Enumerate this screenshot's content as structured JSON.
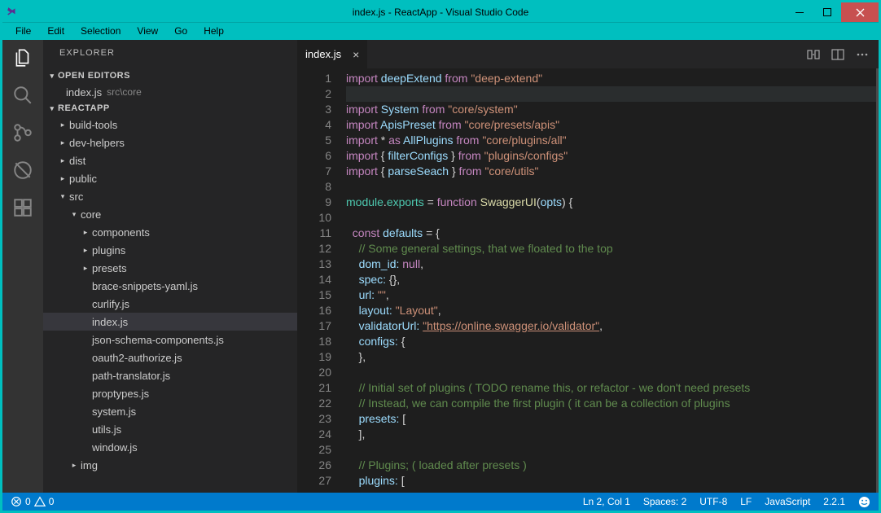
{
  "window": {
    "title": "index.js - ReactApp - Visual Studio Code"
  },
  "menubar": [
    "File",
    "Edit",
    "Selection",
    "View",
    "Go",
    "Help"
  ],
  "activitybar": [
    "files",
    "search",
    "scm",
    "debug",
    "extensions"
  ],
  "explorer": {
    "title": "EXPLORER",
    "sections": {
      "open_editors_label": "OPEN EDITORS",
      "open_editors": [
        {
          "name": "index.js",
          "hint": "src\\core"
        }
      ],
      "project_label": "REACTAPP",
      "tree": [
        {
          "indent": 0,
          "chev": "right",
          "label": "build-tools"
        },
        {
          "indent": 0,
          "chev": "right",
          "label": "dev-helpers"
        },
        {
          "indent": 0,
          "chev": "right",
          "label": "dist"
        },
        {
          "indent": 0,
          "chev": "right",
          "label": "public"
        },
        {
          "indent": 0,
          "chev": "down",
          "label": "src"
        },
        {
          "indent": 1,
          "chev": "down",
          "label": "core"
        },
        {
          "indent": 2,
          "chev": "right",
          "label": "components"
        },
        {
          "indent": 2,
          "chev": "right",
          "label": "plugins"
        },
        {
          "indent": 2,
          "chev": "right",
          "label": "presets"
        },
        {
          "indent": 2,
          "chev": "",
          "label": "brace-snippets-yaml.js"
        },
        {
          "indent": 2,
          "chev": "",
          "label": "curlify.js"
        },
        {
          "indent": 2,
          "chev": "",
          "label": "index.js",
          "selected": true
        },
        {
          "indent": 2,
          "chev": "",
          "label": "json-schema-components.js"
        },
        {
          "indent": 2,
          "chev": "",
          "label": "oauth2-authorize.js"
        },
        {
          "indent": 2,
          "chev": "",
          "label": "path-translator.js"
        },
        {
          "indent": 2,
          "chev": "",
          "label": "proptypes.js"
        },
        {
          "indent": 2,
          "chev": "",
          "label": "system.js"
        },
        {
          "indent": 2,
          "chev": "",
          "label": "utils.js"
        },
        {
          "indent": 2,
          "chev": "",
          "label": "window.js"
        },
        {
          "indent": 1,
          "chev": "right",
          "label": "img"
        }
      ]
    }
  },
  "tabs": {
    "active": "index.js"
  },
  "code": {
    "first_line": 1,
    "highlighted_line": 2,
    "lines": [
      [
        [
          "k",
          "import "
        ],
        [
          "id",
          "deepExtend"
        ],
        [
          "k",
          " from "
        ],
        [
          "s",
          "\"deep-extend\""
        ]
      ],
      [],
      [
        [
          "k",
          "import "
        ],
        [
          "id",
          "System"
        ],
        [
          "k",
          " from "
        ],
        [
          "s",
          "\"core/system\""
        ]
      ],
      [
        [
          "k",
          "import "
        ],
        [
          "id",
          "ApisPreset"
        ],
        [
          "k",
          " from "
        ],
        [
          "s",
          "\"core/presets/apis\""
        ]
      ],
      [
        [
          "k",
          "import "
        ],
        [
          "pu",
          "* "
        ],
        [
          "k",
          "as "
        ],
        [
          "id",
          "AllPlugins"
        ],
        [
          "k",
          " from "
        ],
        [
          "s",
          "\"core/plugins/all\""
        ]
      ],
      [
        [
          "k",
          "import "
        ],
        [
          "pu",
          "{ "
        ],
        [
          "id",
          "filterConfigs"
        ],
        [
          "pu",
          " }"
        ],
        [
          "k",
          " from "
        ],
        [
          "s",
          "\"plugins/configs\""
        ]
      ],
      [
        [
          "k",
          "import "
        ],
        [
          "pu",
          "{ "
        ],
        [
          "id",
          "parseSeach"
        ],
        [
          "pu",
          " }"
        ],
        [
          "k",
          " from "
        ],
        [
          "s",
          "\"core/utils\""
        ]
      ],
      [],
      [
        [
          "ty",
          "module"
        ],
        [
          "pu",
          "."
        ],
        [
          "ty",
          "exports"
        ],
        [
          "pu",
          " = "
        ],
        [
          "k",
          "function"
        ],
        [
          "pu",
          " "
        ],
        [
          "fn",
          "SwaggerUI"
        ],
        [
          "pu",
          "("
        ],
        [
          "id",
          "opts"
        ],
        [
          "pu",
          ") {"
        ]
      ],
      [],
      [
        [
          "pu",
          "  "
        ],
        [
          "k",
          "const"
        ],
        [
          "pu",
          " "
        ],
        [
          "id",
          "defaults"
        ],
        [
          "pu",
          " = {"
        ]
      ],
      [
        [
          "pu",
          "    "
        ],
        [
          "cm",
          "// Some general settings, that we floated to the top"
        ]
      ],
      [
        [
          "pu",
          "    "
        ],
        [
          "id",
          "dom_id:"
        ],
        [
          "pu",
          " "
        ],
        [
          "k",
          "null"
        ],
        [
          "pu",
          ","
        ]
      ],
      [
        [
          "pu",
          "    "
        ],
        [
          "id",
          "spec:"
        ],
        [
          "pu",
          " {},"
        ]
      ],
      [
        [
          "pu",
          "    "
        ],
        [
          "id",
          "url:"
        ],
        [
          "pu",
          " "
        ],
        [
          "s",
          "\"\""
        ],
        [
          "pu",
          ","
        ]
      ],
      [
        [
          "pu",
          "    "
        ],
        [
          "id",
          "layout:"
        ],
        [
          "pu",
          " "
        ],
        [
          "s",
          "\"Layout\""
        ],
        [
          "pu",
          ","
        ]
      ],
      [
        [
          "pu",
          "    "
        ],
        [
          "id",
          "validatorUrl:"
        ],
        [
          "pu",
          " "
        ],
        [
          "s u",
          "\"https://online.swagger.io/validator\""
        ],
        [
          "pu",
          ","
        ]
      ],
      [
        [
          "pu",
          "    "
        ],
        [
          "id",
          "configs:"
        ],
        [
          "pu",
          " {"
        ]
      ],
      [
        [
          "pu",
          "    },"
        ]
      ],
      [],
      [
        [
          "pu",
          "    "
        ],
        [
          "cm",
          "// Initial set of plugins ( TODO rename this, or refactor - we don't need presets"
        ]
      ],
      [
        [
          "pu",
          "    "
        ],
        [
          "cm",
          "// Instead, we can compile the first plugin ( it can be a collection of plugins"
        ]
      ],
      [
        [
          "pu",
          "    "
        ],
        [
          "id",
          "presets:"
        ],
        [
          "pu",
          " ["
        ]
      ],
      [
        [
          "pu",
          "    ],"
        ]
      ],
      [],
      [
        [
          "pu",
          "    "
        ],
        [
          "cm",
          "// Plugins; ( loaded after presets )"
        ]
      ],
      [
        [
          "pu",
          "    "
        ],
        [
          "id",
          "plugins:"
        ],
        [
          "pu",
          " ["
        ]
      ]
    ]
  },
  "status": {
    "errors": "0",
    "warnings": "0",
    "ln_col": "Ln 2, Col 1",
    "spaces": "Spaces: 2",
    "encoding": "UTF-8",
    "eol": "LF",
    "language": "JavaScript",
    "version": "2.2.1"
  }
}
